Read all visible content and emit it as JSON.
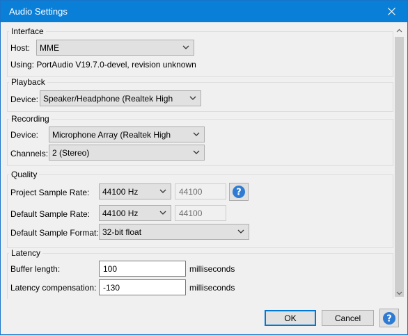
{
  "window": {
    "title": "Audio Settings"
  },
  "interface": {
    "heading": "Interface",
    "host_label": "Host:",
    "host_value": "MME",
    "using_text": "Using: PortAudio V19.7.0-devel, revision unknown"
  },
  "playback": {
    "heading": "Playback",
    "device_label": "Device:",
    "device_value": "Speaker/Headphone (Realtek High"
  },
  "recording": {
    "heading": "Recording",
    "device_label": "Device:",
    "device_value": "Microphone Array (Realtek High",
    "channels_label": "Channels:",
    "channels_value": "2 (Stereo)"
  },
  "quality": {
    "heading": "Quality",
    "project_rate_label": "Project Sample Rate:",
    "project_rate_value": "44100 Hz",
    "project_rate_text": "44100",
    "default_rate_label": "Default Sample Rate:",
    "default_rate_value": "44100 Hz",
    "default_rate_text": "44100",
    "default_format_label": "Default Sample Format:",
    "default_format_value": "32-bit float"
  },
  "latency": {
    "heading": "Latency",
    "buffer_label": "Buffer length:",
    "buffer_value": "100",
    "buffer_unit": "milliseconds",
    "compensation_label": "Latency compensation:",
    "compensation_value": "-130",
    "compensation_unit": "milliseconds"
  },
  "buttons": {
    "ok": "OK",
    "cancel": "Cancel"
  },
  "colors": {
    "titlebar": "#0a7fd8",
    "help_icon": "#2e7bd4",
    "accent_border": "#0078d7"
  }
}
